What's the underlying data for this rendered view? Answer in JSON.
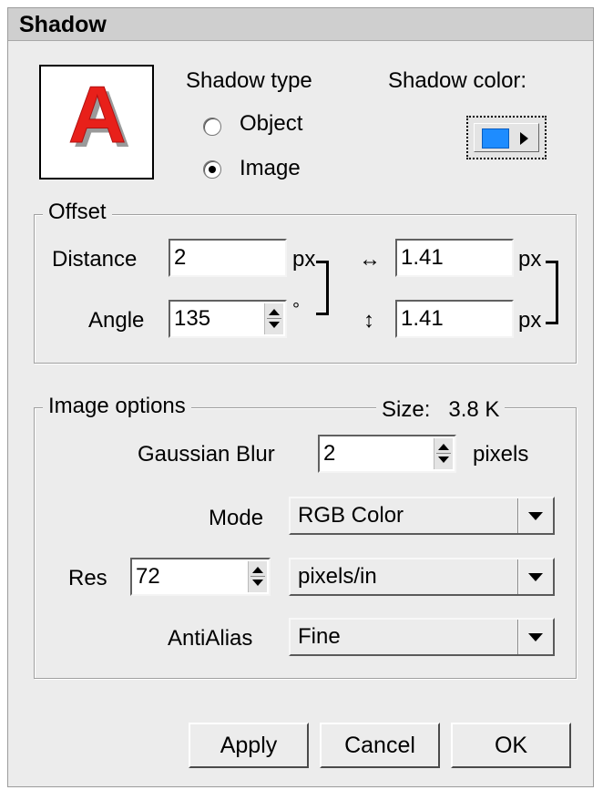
{
  "dialog": {
    "title": "Shadow"
  },
  "preview": {
    "glyph": "A"
  },
  "shadow_type": {
    "label": "Shadow type",
    "options": [
      {
        "label": "Object",
        "selected": false
      },
      {
        "label": "Image",
        "selected": true
      }
    ]
  },
  "shadow_color": {
    "label": "Shadow color:",
    "color": "#1e8cff"
  },
  "offset": {
    "legend": "Offset",
    "distance_label": "Distance",
    "distance_value": "2",
    "distance_unit": "px",
    "angle_label": "Angle",
    "angle_value": "135",
    "angle_unit": "°",
    "horizontal_icon": "↔",
    "horizontal_value": "1.41",
    "horizontal_unit": "px",
    "vertical_icon": "↕",
    "vertical_value": "1.41",
    "vertical_unit": "px"
  },
  "image_options": {
    "legend": "Image options",
    "size_label": "Size:",
    "size_value": "3.8 K",
    "blur_label": "Gaussian Blur",
    "blur_value": "2",
    "blur_unit": "pixels",
    "mode_label": "Mode",
    "mode_value": "RGB Color",
    "res_label": "Res",
    "res_value": "72",
    "res_unit_value": "pixels/in",
    "antialias_label": "AntiAlias",
    "antialias_value": "Fine"
  },
  "buttons": {
    "apply": "Apply",
    "cancel": "Cancel",
    "ok": "OK"
  }
}
